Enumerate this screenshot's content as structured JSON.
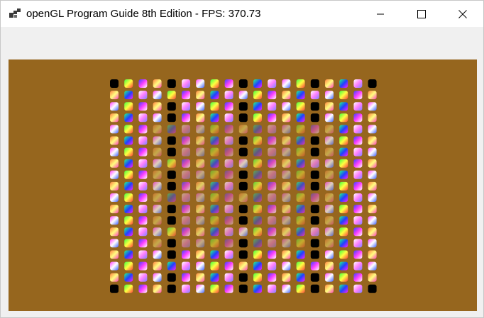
{
  "window": {
    "title": "openGL Program Guide 8th Edition - FPS: 370.73"
  },
  "controls": {
    "minimize_icon": "minimize-icon",
    "maximize_icon": "maximize-icon",
    "close_icon": "close-icon"
  },
  "colors": {
    "titlebar": "#ffffff",
    "client": "#f0f0f0",
    "viewport_clear": "#96661e"
  }
}
